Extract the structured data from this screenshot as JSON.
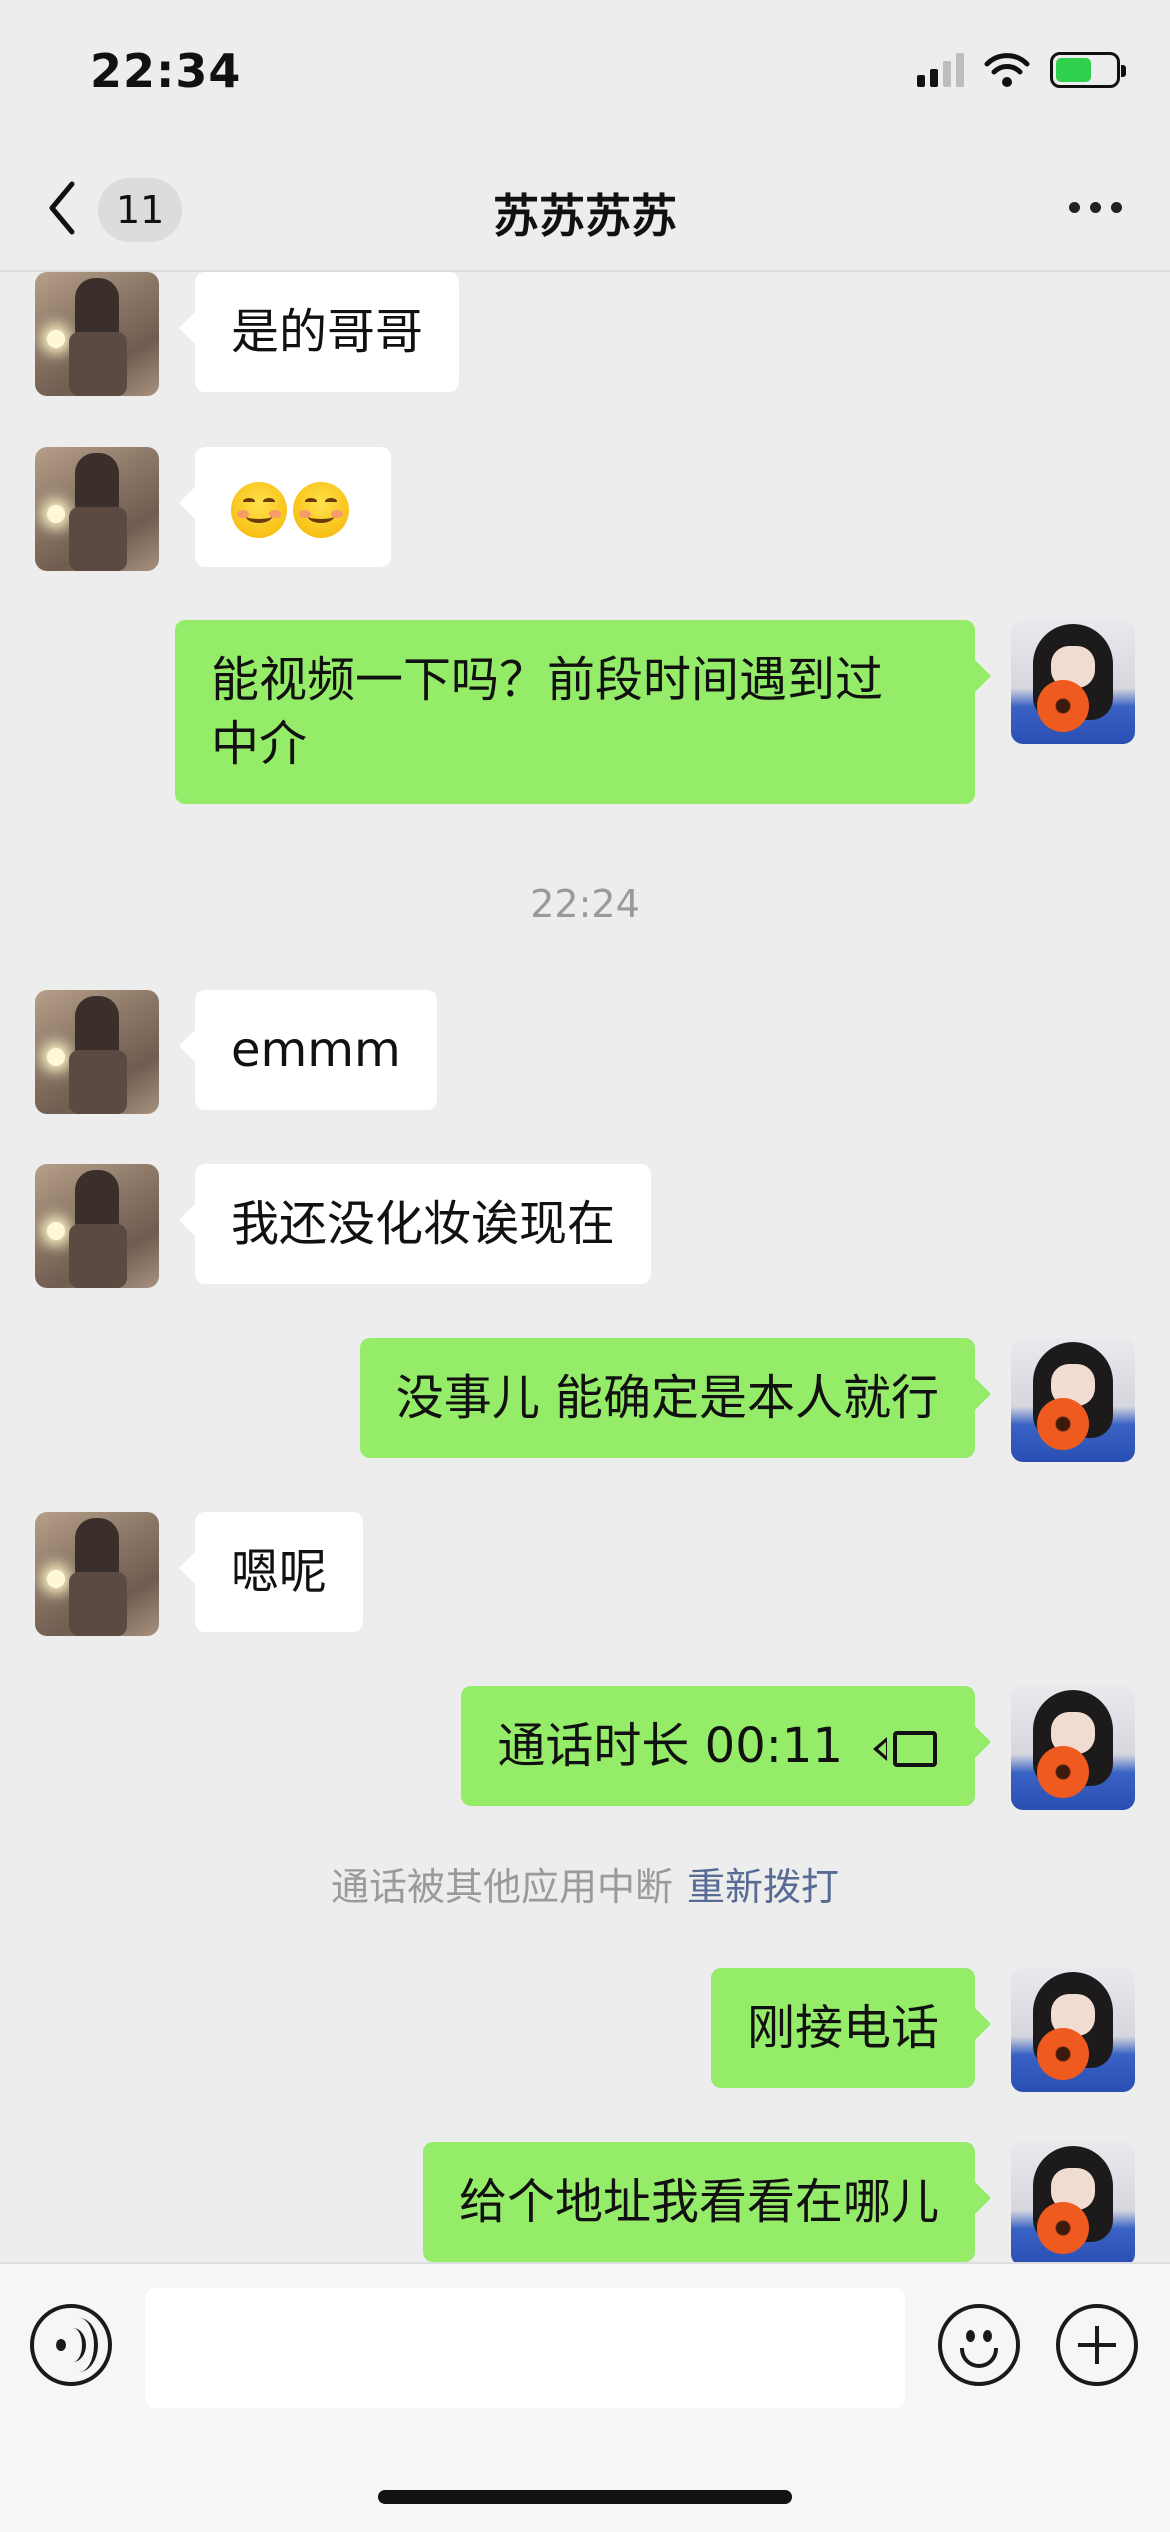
{
  "status_bar": {
    "time": "22:34"
  },
  "nav": {
    "back_count": "11",
    "title": "苏苏苏苏"
  },
  "messages": [
    {
      "side": "in",
      "text": "是的哥哥"
    },
    {
      "side": "in",
      "text": "",
      "emoji": [
        "smiling-face-icon",
        "smiling-face-icon"
      ]
    },
    {
      "side": "out",
      "line1": "能视频一下吗？前段时间遇到过",
      "line2": "中介"
    },
    {
      "side": "in",
      "text": "emmm"
    },
    {
      "side": "in",
      "text": "我还没化妆诶现在"
    },
    {
      "side": "out",
      "text": "没事儿 能确定是本人就行"
    },
    {
      "side": "in",
      "text": "嗯呢"
    },
    {
      "side": "out",
      "text": "通话时长 00:11",
      "icon": "video-call-icon"
    },
    {
      "side": "out",
      "text": "刚接电话"
    },
    {
      "side": "out",
      "text": "给个地址我看看在哪儿"
    }
  ],
  "timestamp": "22:24",
  "system_notice": {
    "text": "通话被其他应用中断",
    "link": "重新拨打"
  },
  "input": {
    "value": "",
    "placeholder": ""
  }
}
